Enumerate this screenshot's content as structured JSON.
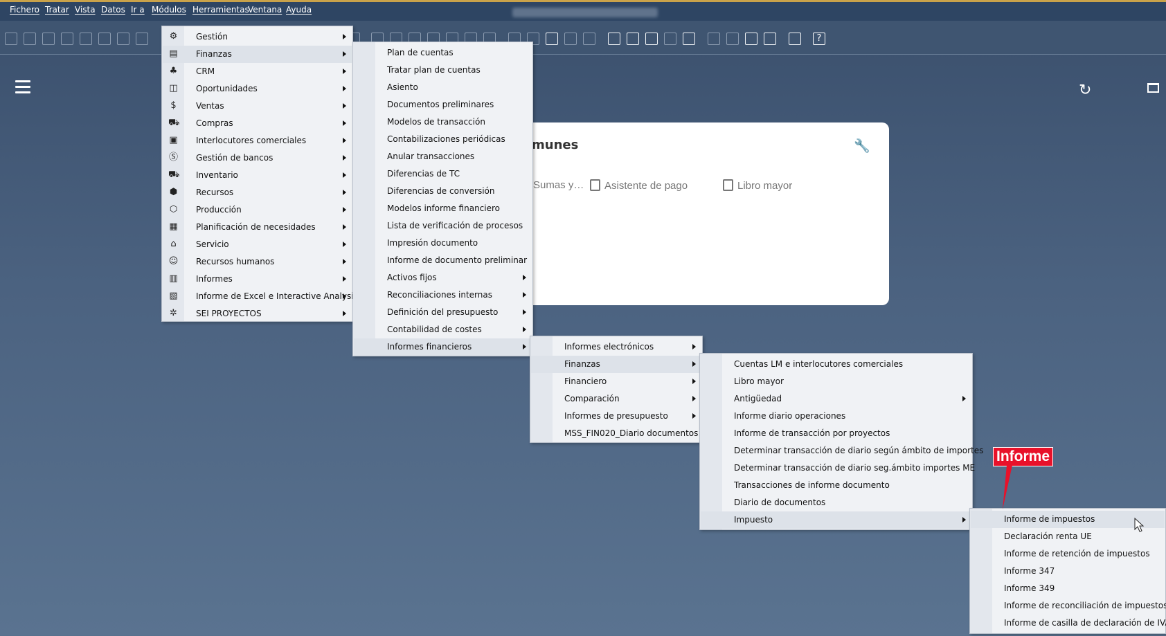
{
  "menubar": {
    "items": [
      "Fichero",
      "Tratar",
      "Vista",
      "Datos",
      "Ir a",
      "Módulos",
      "Herramientas",
      "Ventana",
      "Ayuda"
    ]
  },
  "toolbar": {
    "help_label": "?"
  },
  "card": {
    "title": "munes",
    "items": [
      "Sumas y…",
      "Asistente de pago",
      "Libro mayor"
    ]
  },
  "menus": {
    "modulos": [
      {
        "label": "Gestión",
        "icon": "gear-icon",
        "submenu": true
      },
      {
        "label": "Finanzas",
        "icon": "finance-icon",
        "submenu": true,
        "highlighted": true
      },
      {
        "label": "CRM",
        "icon": "crm-icon",
        "submenu": true
      },
      {
        "label": "Oportunidades",
        "icon": "chart-icon",
        "submenu": true
      },
      {
        "label": "Ventas",
        "icon": "dollar-icon",
        "submenu": true
      },
      {
        "label": "Compras",
        "icon": "cart-icon",
        "submenu": true
      },
      {
        "label": "Interlocutores comerciales",
        "icon": "contacts-icon",
        "submenu": true
      },
      {
        "label": "Gestión de bancos",
        "icon": "bank-money-icon",
        "submenu": true
      },
      {
        "label": "Inventario",
        "icon": "inventory-icon",
        "submenu": true
      },
      {
        "label": "Recursos",
        "icon": "cube-icon",
        "submenu": true
      },
      {
        "label": "Producción",
        "icon": "box-icon",
        "submenu": true
      },
      {
        "label": "Planificación de necesidades",
        "icon": "calendar-icon",
        "submenu": true
      },
      {
        "label": "Servicio",
        "icon": "building-icon",
        "submenu": true
      },
      {
        "label": "Recursos humanos",
        "icon": "person-icon",
        "submenu": true
      },
      {
        "label": "Informes",
        "icon": "report-icon",
        "submenu": true
      },
      {
        "label": "Informe de Excel e Interactive Analysis",
        "icon": "excel-icon",
        "submenu": true
      },
      {
        "label": "SEI PROYECTOS",
        "icon": "cog-icon",
        "submenu": true
      }
    ],
    "finanzas": [
      {
        "label": "Plan de cuentas"
      },
      {
        "label": "Tratar plan de cuentas"
      },
      {
        "label": "Asiento"
      },
      {
        "label": "Documentos preliminares"
      },
      {
        "label": "Modelos de transacción"
      },
      {
        "label": "Contabilizaciones periódicas"
      },
      {
        "label": "Anular transacciones"
      },
      {
        "label": "Diferencias de TC"
      },
      {
        "label": "Diferencias de conversión"
      },
      {
        "label": "Modelos informe financiero"
      },
      {
        "label": "Lista de verificación de procesos"
      },
      {
        "label": "Impresión documento"
      },
      {
        "label": "Informe de documento preliminar"
      },
      {
        "label": "Activos fijos",
        "submenu": true
      },
      {
        "label": "Reconciliaciones internas",
        "submenu": true
      },
      {
        "label": "Definición del presupuesto",
        "submenu": true
      },
      {
        "label": "Contabilidad de costes",
        "submenu": true
      },
      {
        "label": "Informes financieros",
        "submenu": true,
        "highlighted": true
      }
    ],
    "informes_financieros": [
      {
        "label": "Informes electrónicos",
        "submenu": true
      },
      {
        "label": "Finanzas",
        "submenu": true,
        "highlighted": true
      },
      {
        "label": "Financiero",
        "submenu": true
      },
      {
        "label": "Comparación",
        "submenu": true
      },
      {
        "label": "Informes de presupuesto",
        "submenu": true
      },
      {
        "label": "MSS_FIN020_Diario documentos"
      }
    ],
    "finanzas_informes": [
      {
        "label": "Cuentas LM e interlocutores comerciales"
      },
      {
        "label": "Libro mayor"
      },
      {
        "label": "Antigüedad",
        "submenu": true
      },
      {
        "label": "Informe diario operaciones"
      },
      {
        "label": "Informe de transacción por proyectos"
      },
      {
        "label": "Determinar transacción de diario según ámbito de importes"
      },
      {
        "label": "Determinar transacción de diario seg.ámbito importes ME"
      },
      {
        "label": "Transacciones de informe documento"
      },
      {
        "label": "Diario de documentos"
      },
      {
        "label": "Impuesto",
        "submenu": true,
        "highlighted": true
      }
    ],
    "impuesto": [
      {
        "label": "Informe de impuestos",
        "highlighted": true
      },
      {
        "label": "Declaración renta UE"
      },
      {
        "label": "Informe de retención de impuestos"
      },
      {
        "label": "Informe 347"
      },
      {
        "label": "Informe 349"
      },
      {
        "label": "Informe de reconciliación de impuestos"
      },
      {
        "label": "Informe de casilla de declaración de IVA"
      }
    ]
  },
  "annotation": {
    "label": "Informe",
    "color": "#e8112a"
  }
}
